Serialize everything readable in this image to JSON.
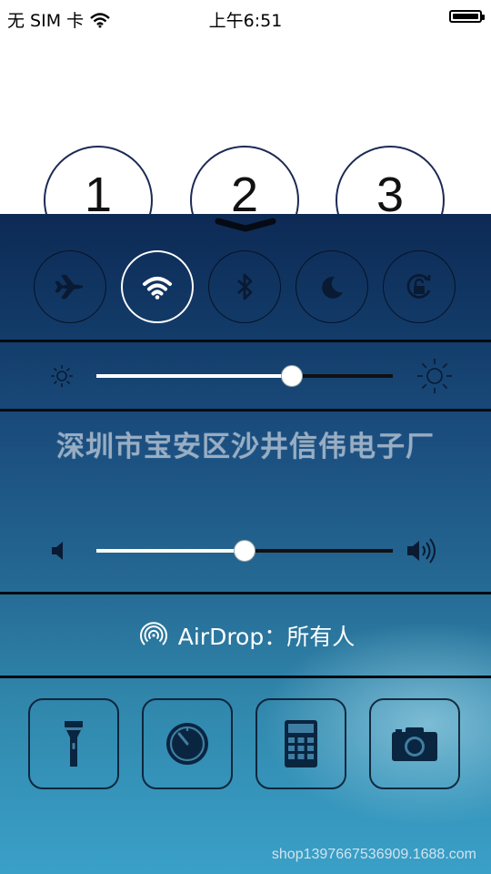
{
  "status_bar": {
    "carrier": "无 SIM 卡",
    "time": "上午6:51",
    "wifi_icon": "wifi-icon",
    "battery_icon": "battery-icon"
  },
  "keypad": {
    "keys": [
      "1",
      "2",
      "3"
    ]
  },
  "control_center": {
    "grabber_icon": "chevron-down-icon",
    "toggles": [
      {
        "name": "airplane-mode",
        "icon": "airplane-icon",
        "active": false
      },
      {
        "name": "wifi",
        "icon": "wifi-icon",
        "active": true
      },
      {
        "name": "bluetooth",
        "icon": "bluetooth-icon",
        "active": false
      },
      {
        "name": "do-not-disturb",
        "icon": "moon-icon",
        "active": false
      },
      {
        "name": "rotation-lock",
        "icon": "rotation-lock-icon",
        "active": false
      }
    ],
    "brightness": {
      "value": 0.66,
      "min_icon": "sun-small-icon",
      "max_icon": "sun-large-icon"
    },
    "volume": {
      "value": 0.5,
      "min_icon": "speaker-icon",
      "max_icon": "speaker-loud-icon"
    },
    "airdrop": {
      "label": "AirDrop：所有人",
      "icon": "airdrop-icon"
    },
    "tools": [
      {
        "name": "flashlight",
        "icon": "flashlight-icon"
      },
      {
        "name": "timer",
        "icon": "timer-icon"
      },
      {
        "name": "calculator",
        "icon": "calculator-icon"
      },
      {
        "name": "camera",
        "icon": "camera-icon"
      }
    ]
  },
  "watermark": "深圳市宝安区沙井信伟电子厂",
  "shop_watermark": "shop1397667536909.1688.com",
  "colors": {
    "panel_top": "#0d2a55",
    "panel_bottom": "#3aa0c8",
    "icon_dark": "#0a1a33",
    "active": "#ffffff"
  }
}
